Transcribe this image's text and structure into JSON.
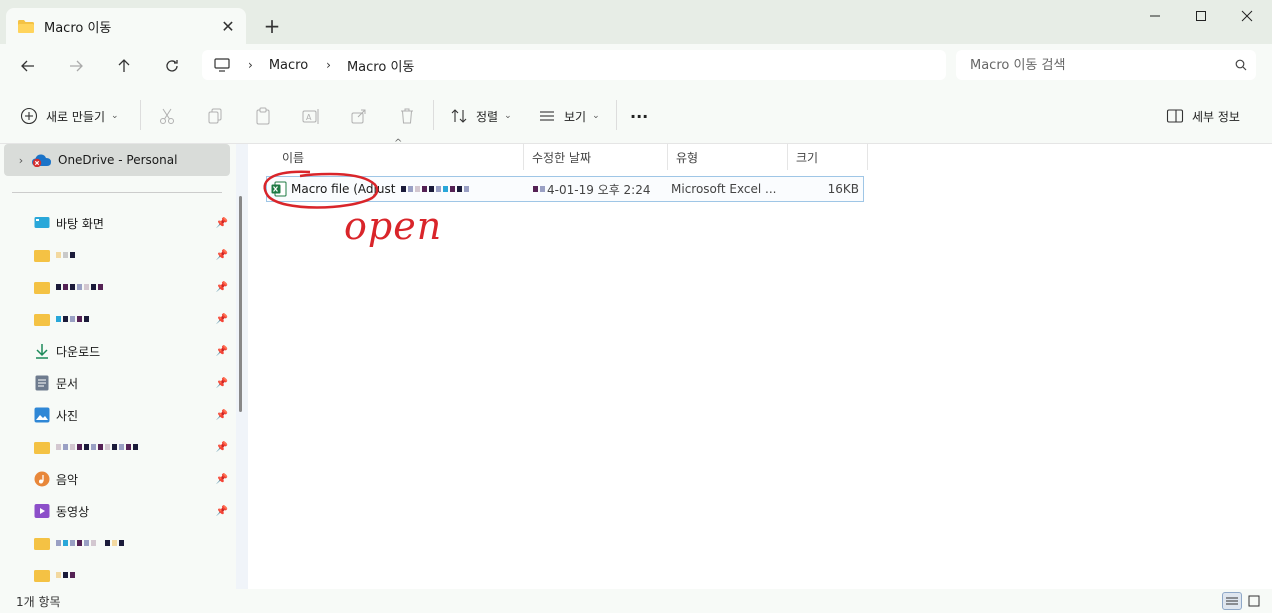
{
  "tab": {
    "title": "Macro 이동"
  },
  "address": {
    "crumbs": [
      "Macro",
      "Macro 이동"
    ]
  },
  "search": {
    "placeholder": "Macro 이동 검색"
  },
  "commands": {
    "new": "새로 만들기",
    "sort": "정렬",
    "view": "보기",
    "more": "···",
    "details": "세부 정보"
  },
  "sidebar": {
    "onedrive": "OneDrive - Personal",
    "items": [
      {
        "label": "바탕 화면",
        "icon": "desktop-icon"
      },
      {
        "label": "",
        "icon": "folder-icon"
      },
      {
        "label": "",
        "icon": "folder-icon"
      },
      {
        "label": "",
        "icon": "folder-icon"
      },
      {
        "label": "다운로드",
        "icon": "download-icon"
      },
      {
        "label": "문서",
        "icon": "documents-icon"
      },
      {
        "label": "사진",
        "icon": "pictures-icon"
      },
      {
        "label": "",
        "icon": "folder-icon"
      },
      {
        "label": "음악",
        "icon": "music-icon"
      },
      {
        "label": "동영상",
        "icon": "videos-icon"
      },
      {
        "label": "",
        "icon": "folder-icon"
      },
      {
        "label": "",
        "icon": "folder-icon"
      }
    ]
  },
  "columns": [
    "이름",
    "수정한 날짜",
    "유형",
    "크기"
  ],
  "files": [
    {
      "name": "Macro file (Adjust",
      "date": "4-01-19 오후 2:24",
      "type": "Microsoft Excel ...",
      "size": "16KB"
    }
  ],
  "annotation": "open",
  "status": "1개 항목",
  "colors": {
    "annotation": "#d9252a",
    "selection_border": "#9fc6e6",
    "folder": "#f4c244",
    "excel": "#1d7a43"
  }
}
